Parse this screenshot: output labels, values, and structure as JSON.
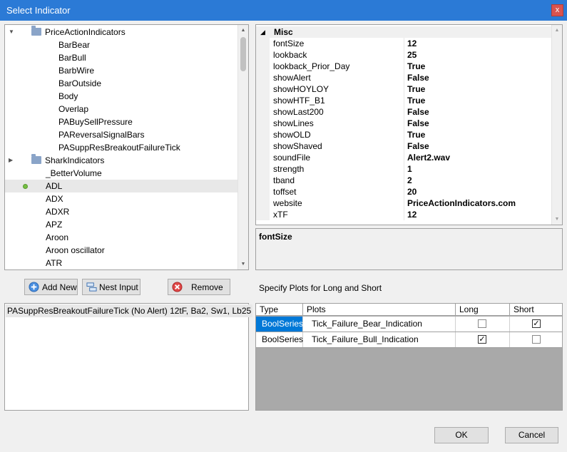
{
  "window": {
    "title": "Select Indicator",
    "close_glyph": "x"
  },
  "tree": {
    "folder1": "PriceActionIndicators",
    "children1": [
      "BarBear",
      "BarBull",
      "BarbWire",
      "BarOutside",
      "Body",
      "Overlap",
      "PABuySellPressure",
      "PAReversalSignalBars",
      "PASuppResBreakoutFailureTick"
    ],
    "folder2": "SharkIndicators",
    "items": [
      "_BetterVolume",
      "ADL",
      "ADX",
      "ADXR",
      "APZ",
      "Aroon",
      "Aroon oscillator",
      "ATR"
    ],
    "selected": "ADL"
  },
  "properties": {
    "category": "Misc",
    "rows": [
      {
        "name": "fontSize",
        "value": "12"
      },
      {
        "name": "lookback",
        "value": "25"
      },
      {
        "name": "lookback_Prior_Day",
        "value": "True"
      },
      {
        "name": "showAlert",
        "value": "False"
      },
      {
        "name": "showHOYLOY",
        "value": "True"
      },
      {
        "name": "showHTF_B1",
        "value": "True"
      },
      {
        "name": "showLast200",
        "value": "False"
      },
      {
        "name": "showLines",
        "value": "False"
      },
      {
        "name": "showOLD",
        "value": "True"
      },
      {
        "name": "showShaved",
        "value": "False"
      },
      {
        "name": "soundFile",
        "value": "Alert2.wav"
      },
      {
        "name": "strength",
        "value": "1"
      },
      {
        "name": "tband",
        "value": "2"
      },
      {
        "name": "toffset",
        "value": "20"
      },
      {
        "name": "website",
        "value": "PriceActionIndicators.com"
      },
      {
        "name": "xTF",
        "value": "12"
      }
    ],
    "description_title": "fontSize"
  },
  "buttons": {
    "add_new": "Add New",
    "nest_input": "Nest Input",
    "remove": "Remove",
    "ok": "OK",
    "cancel": "Cancel"
  },
  "plots_label": "Specify Plots for Long and Short",
  "selected_list": [
    "PASuppResBreakoutFailureTick (No Alert) 12tF,  Ba2,  Sw1,  Lb25"
  ],
  "plots_grid": {
    "headers": [
      "Type",
      "Plots",
      "Long",
      "Short"
    ],
    "rows": [
      {
        "type": "BoolSeries",
        "plot": "Tick_Failure_Bear_Indication",
        "long": false,
        "short": true
      },
      {
        "type": "BoolSeries",
        "plot": "Tick_Failure_Bull_Indication",
        "long": true,
        "short": false
      }
    ],
    "check_glyph": "✓"
  },
  "colors": {
    "titlebar": "#2b7ad6",
    "selection": "#0078d7",
    "adl_dot": "#76c043"
  }
}
